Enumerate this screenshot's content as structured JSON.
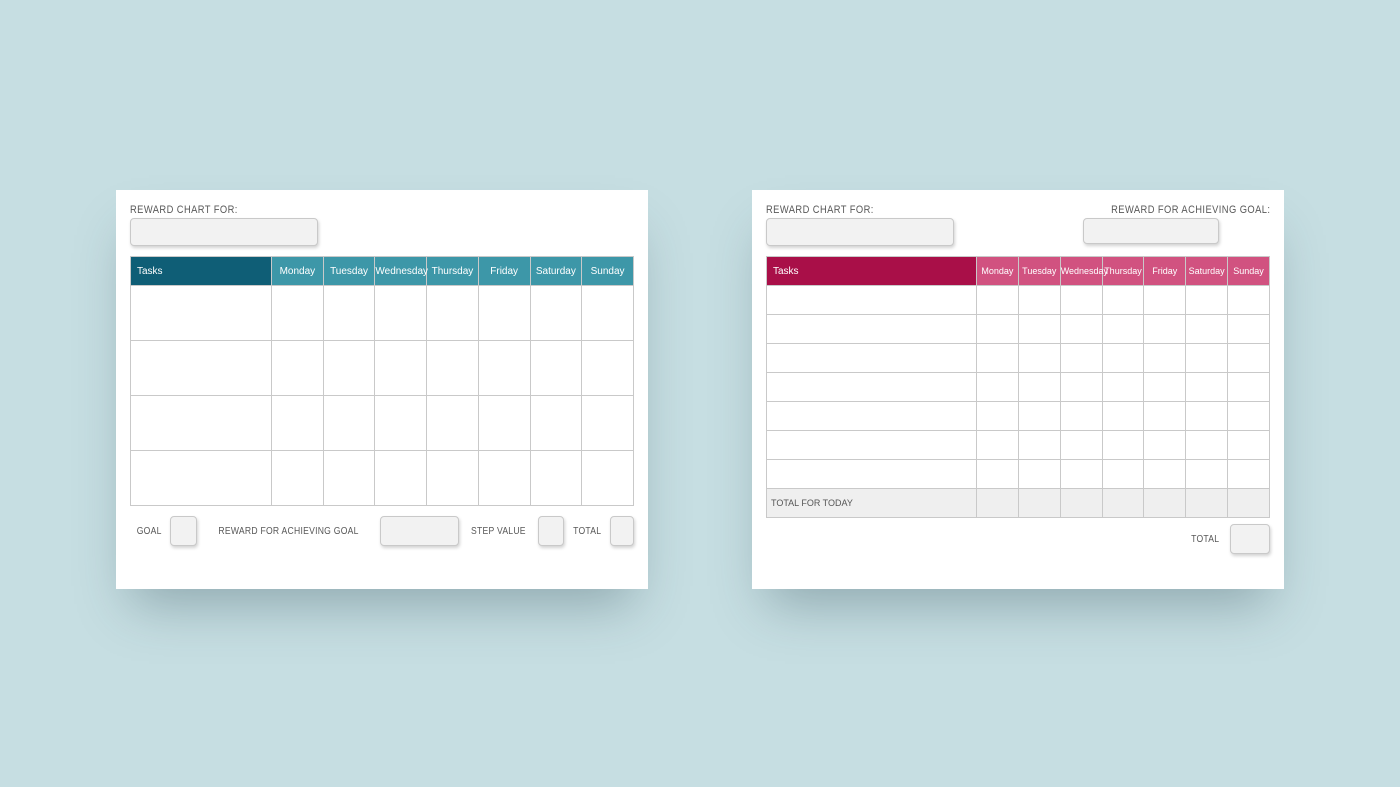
{
  "left": {
    "title_label": "REWARD CHART FOR:",
    "header": {
      "tasks": "Tasks",
      "days": [
        "Monday",
        "Tuesday",
        "Wednesday",
        "Thursday",
        "Friday",
        "Saturday",
        "Sunday"
      ]
    },
    "rows": 4,
    "footer": {
      "goal": "GOAL",
      "reward": "REWARD FOR ACHIEVING GOAL",
      "step_value": "STEP VALUE",
      "total": "TOTAL"
    }
  },
  "right": {
    "title_label": "REWARD CHART FOR:",
    "reward_label": "REWARD FOR ACHIEVING GOAL:",
    "header": {
      "tasks": "Tasks",
      "days": [
        "Monday",
        "Tuesday",
        "Wednesday",
        "Thursday",
        "Friday",
        "Saturday",
        "Sunday"
      ]
    },
    "rows": 7,
    "total_row_label": "TOTAL FOR TODAY",
    "footer": {
      "total": "TOTAL"
    }
  },
  "colors": {
    "bg": "#c6dee2",
    "teal_dark": "#0f5e76",
    "teal": "#3d97a8",
    "magenta_dark": "#a90f48",
    "magenta": "#d15280"
  }
}
